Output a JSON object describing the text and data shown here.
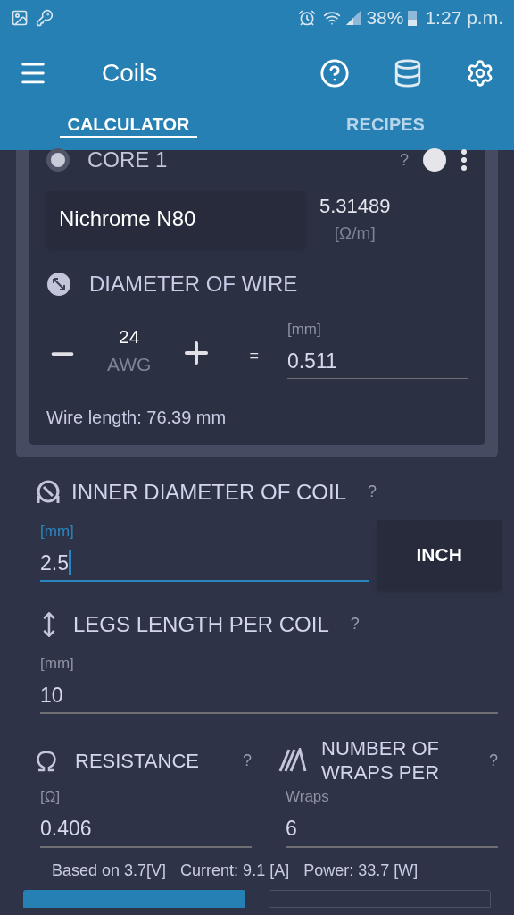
{
  "status_bar": {
    "battery": "38%",
    "time": "1:27 p.m."
  },
  "app_bar": {
    "title": "Coils"
  },
  "tabs": [
    {
      "label": "CALCULATOR",
      "selected": true
    },
    {
      "label": "RECIPES",
      "selected": false
    }
  ],
  "core": {
    "title": "CORE 1",
    "help": "?",
    "material": "Nichrome N80",
    "resistivity": "5.31489",
    "resistivity_unit": "[Ω/m]",
    "diameter_title": "DIAMETER OF WIRE",
    "gauge": "24",
    "gauge_unit": "AWG",
    "equals": "=",
    "diameter_unit": "[mm]",
    "diameter_value": "0.511",
    "wire_length": "Wire length: 76.39 mm"
  },
  "inner_diameter": {
    "title": "INNER DIAMETER OF COIL",
    "help": "?",
    "unit": "[mm]",
    "value": "2.5",
    "focused": true,
    "unit_button": "INCH"
  },
  "legs": {
    "title": "LEGS LENGTH PER COIL",
    "help": "?",
    "unit": "[mm]",
    "value": "10",
    "focused": false
  },
  "resistance": {
    "title": "RESISTANCE",
    "help": "?",
    "unit": "[Ω]",
    "value": "0.406",
    "focused": false
  },
  "wraps": {
    "title": "NUMBER OF WRAPS PER",
    "help": "?",
    "unit": "Wraps",
    "value": "6",
    "focused": false
  },
  "summary": [
    "Based on 3.7[V]",
    "Current: 9.1 [A]",
    "Power: 33.7 [W]"
  ]
}
